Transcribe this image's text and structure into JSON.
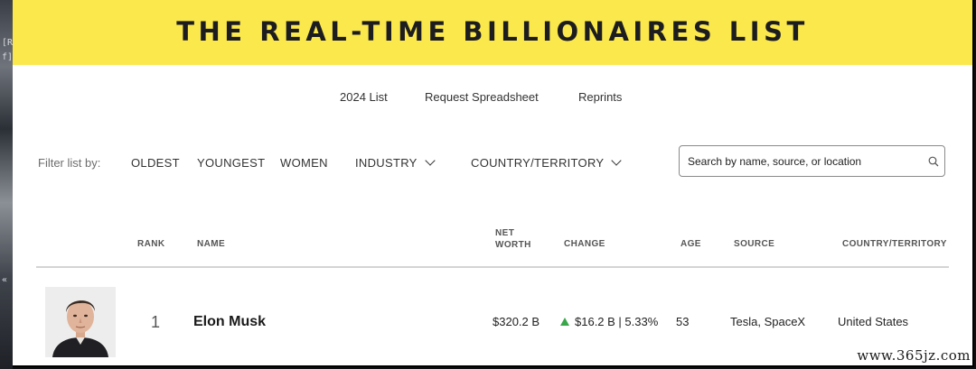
{
  "banner": {
    "title": "THE REAL-TIME BILLIONAIRES LIST"
  },
  "subnav": {
    "items": [
      "2024 List",
      "Request Spreadsheet",
      "Reprints"
    ]
  },
  "filters": {
    "label": "Filter list by:",
    "options": [
      "OLDEST",
      "YOUNGEST",
      "WOMEN",
      "INDUSTRY",
      "COUNTRY/TERRITORY"
    ]
  },
  "search": {
    "placeholder": "Search by name, source, or location"
  },
  "table": {
    "headers": {
      "rank": "RANK",
      "name": "NAME",
      "net_worth_1": "NET",
      "net_worth_2": "WORTH",
      "change": "CHANGE",
      "age": "AGE",
      "source": "SOURCE",
      "country": "COUNTRY/TERRITORY"
    },
    "rows": [
      {
        "rank": "1",
        "name": "Elon Musk",
        "net_worth": "$320.2 B",
        "change": "$16.2 B | 5.33%",
        "change_direction": "up",
        "age": "53",
        "source": "Tesla, SpaceX",
        "country": "United States"
      }
    ]
  },
  "desktop": {
    "fragments": [
      "[R",
      "f]",
      "«"
    ]
  },
  "watermark": "www.365jz.com",
  "colors": {
    "banner": "#fbe84d",
    "up": "#3aa64a"
  },
  "icons": [
    "search-icon",
    "chevron-down-icon",
    "up-arrow-icon"
  ]
}
